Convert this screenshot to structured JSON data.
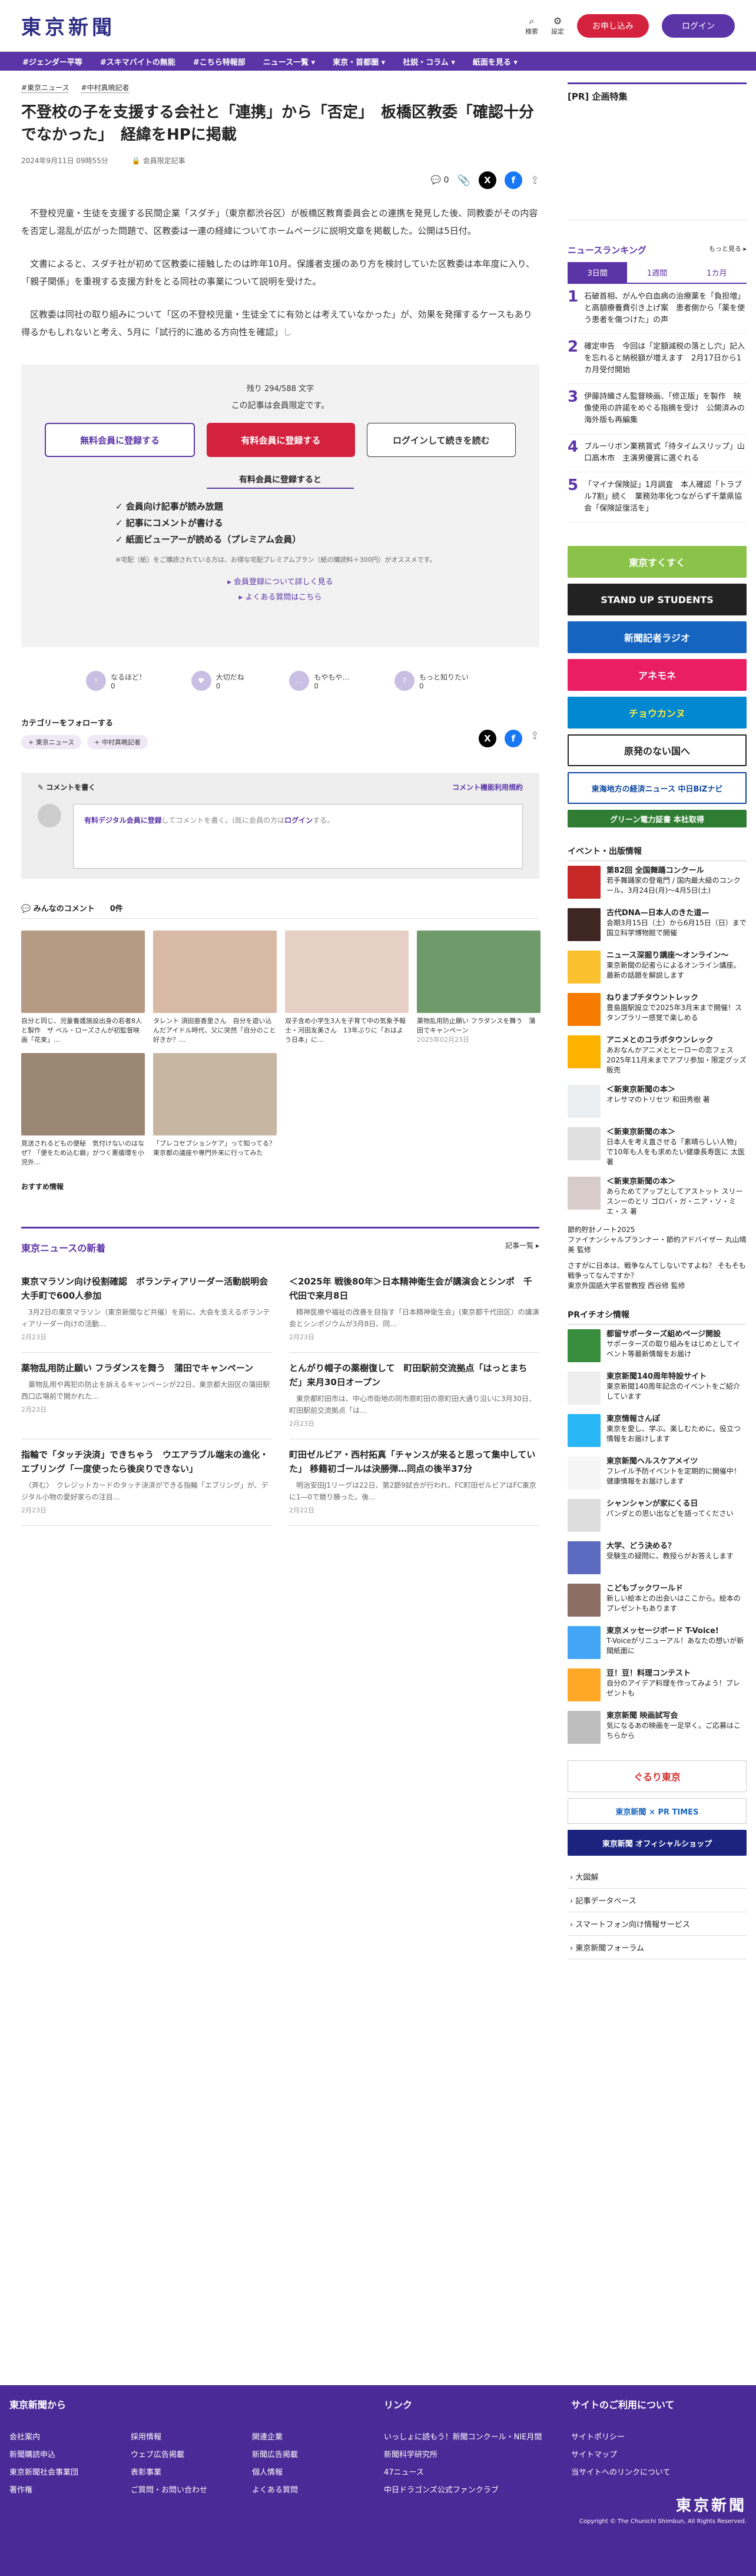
{
  "header": {
    "logo": "東京新聞",
    "search": "検索",
    "settings": "設定",
    "signup": "お申し込み",
    "login": "ログイン"
  },
  "nav": [
    "#ジェンダー平等",
    "#スキマバイトの無能",
    "#こちら特報部",
    "ニュース一覧 ▾",
    "東京・首都圏 ▾",
    "社説・コラム ▾",
    "紙面を見る ▾"
  ],
  "article": {
    "tags": [
      "#東京ニュース",
      "#中村真暁記者"
    ],
    "title": "不登校の子を支援する会社と「連携」から「否定」　板橋区教委「確認十分でなかった」　経緯をHPに掲載",
    "date": "2024年9月11日 09時55分",
    "member_label": "会員限定記事",
    "comments_count": "0",
    "p1": "　不登校児童・生徒を支援する民間企業「スダチ」（東京都渋谷区）が板橋区教育委員会との連携を発見した後、同教委がその内容を否定し混乱が広がった問題で、区教委は一連の経緯についてホームページに説明文章を掲載した。公開は5日付。",
    "p2": "　文書によると、スダチ社が初めて区教委に接触したのは昨年10月。保護者支援のあり方を検討していた区教委は本年度に入り、「親子関係」を重視する支援方針をとる同社の事業について説明を受けた。",
    "p3": "　区教委は同社の取り組みについて「区の不登校児童・生徒全てに有効とは考えていなかった」が、効果を発揮するケースもあり得るかもしれないと考え、5月に「試行的に進める方向性を確認」",
    "p3b": "し",
    "remain": "残り 294/588 文字",
    "members_only": "この記事は会員限定です。",
    "btn_free": "無料会員に登録する",
    "btn_paid": "有料会員に登録する",
    "btn_login": "ログインして続きを読む",
    "benefit_title": "有料会員に登録すると",
    "benefits": [
      "✓ 会員向け記事が読み放題",
      "✓ 記事にコメントが書ける",
      "✓ 紙面ビューアーが読める（プレミアム会員）"
    ],
    "note": "※宅配（紙）をご購読されている方は、お得な宅配プレミアムプラン（紙の購読料＋300円）がオススメです。",
    "link1": "▸ 会員登録について詳しく見る",
    "link2": "▸ よくある質問はこちら"
  },
  "reactions": [
    "なるほど！",
    "大切だね",
    "もやもや…",
    "もっと知りたい"
  ],
  "reaction_counts": [
    "0",
    "0",
    "0",
    "0"
  ],
  "category": {
    "title": "カテゴリーをフォローする",
    "tags": [
      "+ 東京ニュース",
      "+ 中村真暁記者"
    ]
  },
  "comment": {
    "write": "コメントを書く",
    "rule": "コメント機能利用規約",
    "placeholder_a": "有料デジタル会員に登録",
    "placeholder_b": "してコメントを書く。(既に会員の方は",
    "placeholder_c": "ログイン",
    "placeholder_d": "する。"
  },
  "minna": {
    "title": "みんなのコメント",
    "count": "0件"
  },
  "grid": [
    {
      "t": "自分と同じ、児童養護施設出身の若者8人と製作　ザ ベル・ローズさんが初監督映画「花束」…"
    },
    {
      "t": "タレント 須田亜香里さん　自分を遊い込んだアイドル時代、父に突然「自分のこと好きか？…"
    },
    {
      "t": "双子含め小学生3人を子育て中の気象予報士・河田友美さん　13年ぶりに「おはよう日本」に…"
    },
    {
      "t": "薬物乱用防止願い フラダンスを舞う　蒲田でキャンペーン",
      "d": "2025年02月23日"
    },
    {
      "t": "見送されるどもの便秘　気付けないのはなぜ？「便をため込む癖」がつく悪循環を小児外…"
    },
    {
      "t": "「プレコセプションケア」って知ってる？　東京都の議座や専門外来に行ってみた"
    }
  ],
  "osusume": "おすすめ情報",
  "news": {
    "title": "東京ニュースの新着",
    "more": "記事一覧 ▸",
    "items": [
      {
        "h": "東京マラソン向け役割確認　ボランティアリーダー活動説明会　大手町で600人参加",
        "p": "　3月2日の東京マラソン（東京新聞など共催）を前に、大会を支えるボランティアリーダー向けの活動…",
        "d": "2月23日"
      },
      {
        "h": "＜2025年 戦後80年＞日本精神衛生会が講演会とシンポ　千代田で来月8日",
        "p": "　精神医療や福祉の改善を目指す「日本精神衛生会」(東京都千代田区）の講演会とシンポジウムが3月8日、同…",
        "d": "2月23日"
      },
      {
        "h": "薬物乱用防止願い フラダンスを舞う　蒲田でキャンペーン",
        "p": "　薬物乱用や再犯の防止を訴えるキャンペーンが22日、東京都大田区の蒲田駅西口広場前で開かれた…",
        "d": "2月23日"
      },
      {
        "h": "とんがり帽子の薬樹復して　町田駅前交流拠点「はっとまちだ」来月30日オープン",
        "p": "　東京都町田市は、中心市街地の同市原町田の原町田大通り沿いに3月30日、町田駅前交流拠点「は…",
        "d": "2月23日"
      },
      {
        "h": "指輪で「タッチ決済」できちゃう　ウエアラブル端末の進化・エブリング「一度使ったら後戻りできない」",
        "p": "　〈斉む〉　クレジットカードのタッチ決済ができる指輪「エブリング」が、デジタル小物の愛好家らの注目…",
        "d": "2月23日"
      },
      {
        "h": "町田ゼルビア・西村拓真「チャンスが来ると思って集中していた」 移籍初ゴールは決勝弾…同点の後半37分",
        "p": "　明治安田J1リーグは22日、第2節9試合が行われ、FC町田ゼルビアはFC東京に1―0で競り勝った。後…",
        "d": "2月22日"
      }
    ]
  },
  "side": {
    "pr": "[PR] 企画特集",
    "ranking": {
      "title": "ニュースランキング",
      "more": "もっと見る ▸",
      "tabs": [
        "3日間",
        "1週間",
        "1カ月"
      ],
      "items": [
        "石破首相、がんや白血病の治療薬を「負担増」と高額療養費引き上げ案　患者側から「薬を使う患者を傷つけた」の声",
        "確定申告　今回は「定額減税の落とし穴」記入を忘れると納税額が増えます　2月17日から1カ月受付開始",
        "伊藤詩織さん監督映画、「修正版」を製作　映像使用の許諾をめぐる指摘を受け　公開済みの海外版も再編集",
        "ブルーリボン業務賞式「待タイムスリップ」山口高木市　主演男優賞に選ぐれる",
        "「マイナ保険証」1月調査　本人確認「トラブル7割」続く　業務効率化つながらず千葉県協会「保険証復活を」"
      ]
    },
    "banners": [
      "東京すくすく",
      "STAND UP STUDENTS",
      "新聞記者ラジオ",
      "アネモネ",
      "チョウカンヌ",
      "原発のない国へ",
      "東海地方の経済ニュース 中日BiZナビ",
      "グリーン電力証書 本社取得"
    ],
    "events_title": "イベント・出版情報",
    "events": [
      {
        "b": "第82回 全国舞踊コンクール",
        "t": "若手舞踊家の登竜門 / 国内最大級のコンクール。3月24日(月)〜4月5日(土)"
      },
      {
        "b": "古代DNA—日本人のきた道—",
        "t": "会期3月15日（土）から6月15日（日）まで国立科学博物館で開催"
      },
      {
        "b": "ニュース深掘り講座〜オンライン〜",
        "t": "東京新聞の記者らによるオンライン講座。最新の話題を解説します"
      },
      {
        "b": "ねりまプチタウントレック",
        "t": "豊島園駅設立で2025年3月末まで開催！スタンプラリー感覚で楽しめる"
      },
      {
        "b": "アニメとのコラボタウンレック",
        "t": "あおなんかアニメとヒーローの恋フェス2025年11月末までアプリ参加・限定グッズ販売"
      },
      {
        "b": "＜新東京新聞の本＞",
        "t": "オレサマのトリセツ 和田秀樹 著"
      },
      {
        "b": "＜新東京新聞の本＞",
        "t": "日本人を考え直させる「素晴らしい人物」で10年も人をも求めたい健康長寿医に 太医 著"
      },
      {
        "b": "＜新東京新聞の本＞",
        "t": "あらためてアップとしてアストット スリー スンーのとリ ゴロバ・ガ・ニア・ソ・ミエ・ス 著"
      }
    ],
    "extra": [
      "節約貯計ノート2025",
      "ファイナンシャルプランナー・節約アドバイザー 丸山晴美 監修",
      "さすがに日本は、戦争なんてしないですよね？ そもそも戦争ってなんですか？",
      "東京外国語大学名誉教授 西谷修 監修"
    ],
    "pr_event_title": "PRイチオシ情報",
    "pr_events": [
      {
        "b": "都留サポーターズ組めページ開設",
        "t": "サポーターズの取り組みをはじめとしてイベント等最新情報をお届け"
      },
      {
        "b": "東京新聞140周年特設サイト",
        "t": "東京新聞140周年記念のイベントをご紹介しています"
      },
      {
        "b": "東京情報さんぽ",
        "t": "東京を愛し、学ぶ。楽しむために。役立つ情報をお届けします"
      },
      {
        "b": "東京新聞ヘルスケアメイツ",
        "t": "フレイル予防イベントを定期的に開催中！健康情報をお届けします"
      },
      {
        "b": "シャンシャンが家にくる日",
        "t": "パンダとの思い出などを語ってください"
      },
      {
        "b": "大学、どう決める？",
        "t": "受験生の疑問に、教授らがお答えします"
      },
      {
        "b": "こどもブックワールド",
        "t": "新しい絵本との出会いはここから。絵本のプレゼントもあります"
      },
      {
        "b": "東京メッセージボード T-Voice!",
        "t": "T-Voiceがリニューアル！あなたの想いが新聞紙面に"
      },
      {
        "b": "豆！豆！料理コンテスト",
        "t": "自分のアイデア料理を作ってみよう！プレゼントも"
      },
      {
        "b": "東京新聞 映画試写会",
        "t": "気になるあの映画を一足早く。ご応募はこちらから"
      }
    ],
    "shop_banners": [
      "ぐるり東京",
      "東京新聞 × PR TIMES",
      "東京新聞 オフィシャルショップ"
    ],
    "links": [
      "大図解",
      "記事データベース",
      "スマートフォン向け情報サービス",
      "東京新聞フォーラム"
    ]
  },
  "footer": {
    "c1_title": "東京新聞から",
    "c2_title": "リンク",
    "c3_title": "サイトのご利用について",
    "c1": [
      "会社案内",
      "採用情報",
      "関連企業",
      "新聞購読申込",
      "ウェブ広告掲載",
      "新聞広告掲載",
      "東京新聞社会事業団",
      "表彰事業",
      "個人情報",
      "著作権",
      "ご質問・お問い合わせ",
      "よくある質問"
    ],
    "c2": [
      "いっしょに読もう！新聞コンクール・NIE月間",
      "新聞科学研究所",
      "47ニュース",
      "中日ドラゴンズ公式ファンクラブ"
    ],
    "c3": [
      "サイトポリシー",
      "サイトマップ",
      "当サイトへのリンクについて"
    ],
    "copyright": "Copyright © The Chunichi Shimbun, All Rights Reserved."
  },
  "colors": {
    "brand": "#5b35a8",
    "accent": "#d4213d"
  }
}
